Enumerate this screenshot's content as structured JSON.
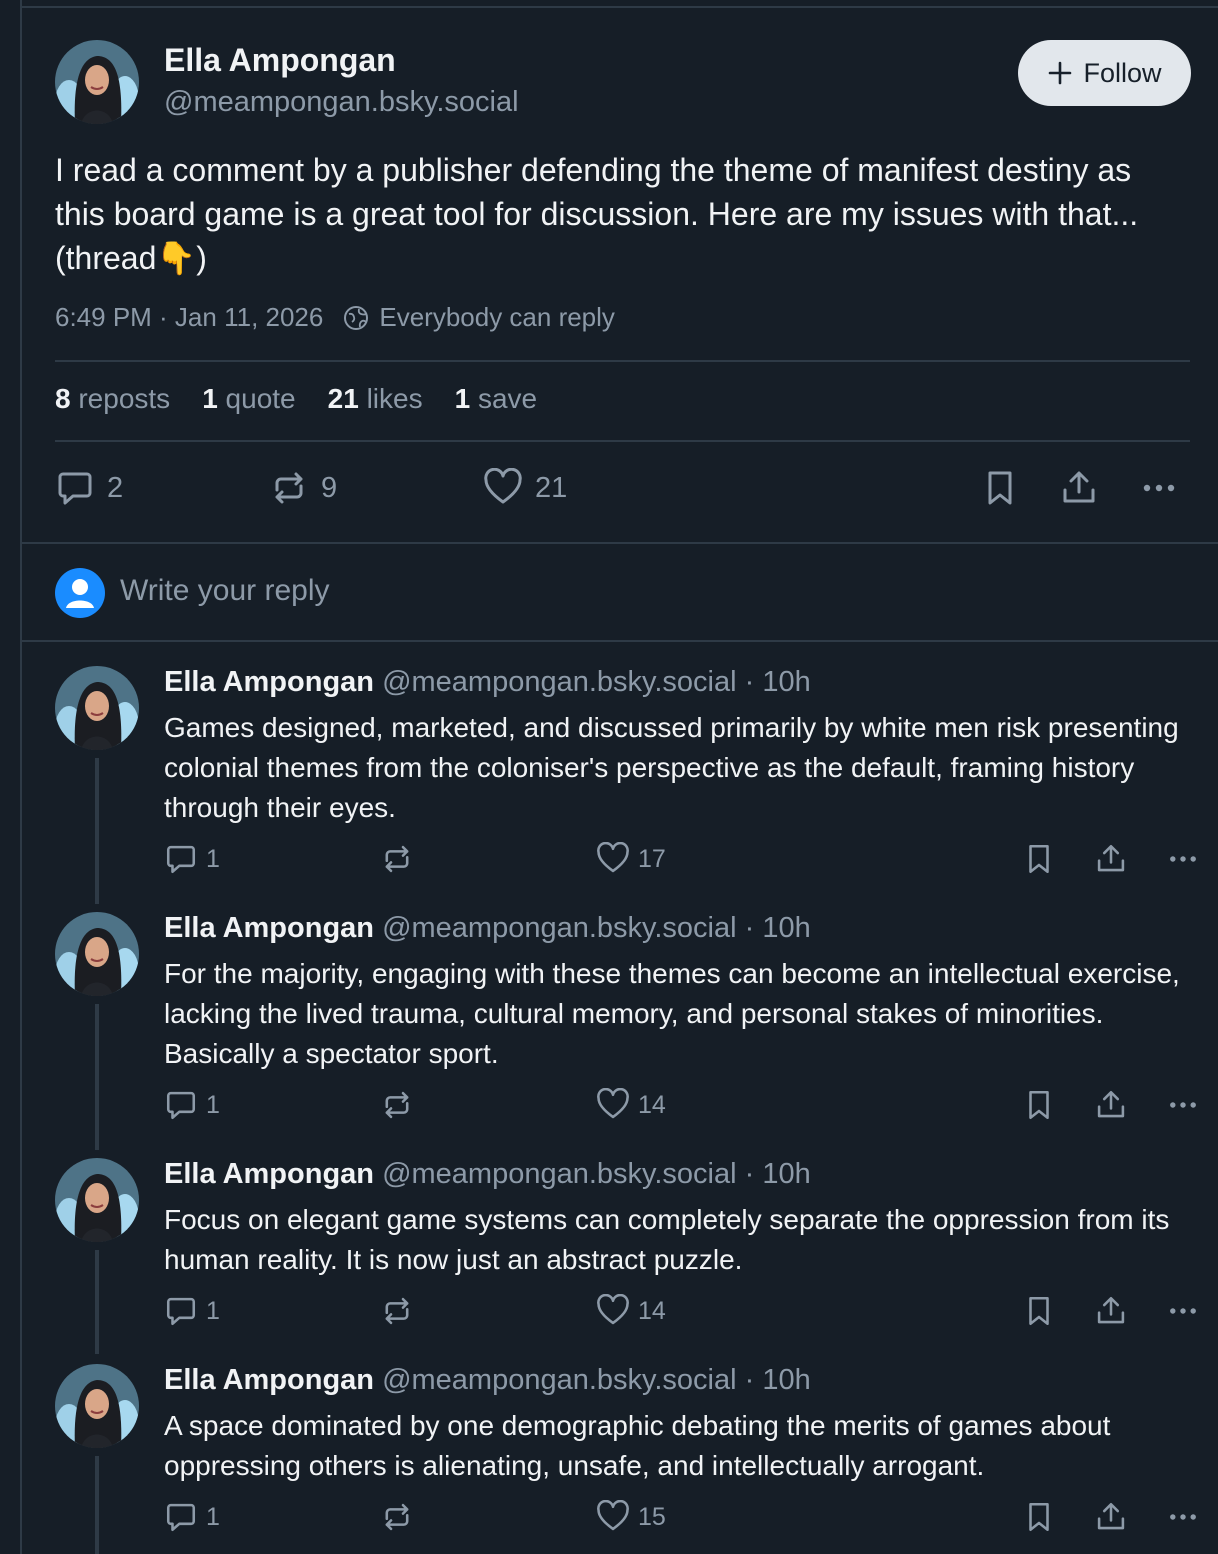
{
  "post": {
    "author_name": "Ella Ampongan",
    "author_handle": "@meampongan.bsky.social",
    "follow_label": "Follow",
    "text": "I read a comment by a publisher defending the theme of manifest destiny as this board game is a great tool for discussion. Here are my issues with that... (thread👇)",
    "timestamp": "6:49 PM · Jan 11, 2026",
    "reply_setting": "Everybody can reply",
    "stats": {
      "reposts_count": "8",
      "reposts_label": "reposts",
      "quotes_count": "1",
      "quotes_label": "quote",
      "likes_count": "21",
      "likes_label": "likes",
      "saves_count": "1",
      "saves_label": "save"
    },
    "actions": {
      "replies": "2",
      "reposts": "9",
      "likes": "21"
    }
  },
  "composer": {
    "placeholder": "Write your reply"
  },
  "thread": [
    {
      "name": "Ella Ampongan",
      "handle": "@meampongan.bsky.social · 10h",
      "text": "Games designed, marketed, and discussed primarily by white men risk presenting colonial themes from the coloniser's perspective as the default, framing history through their eyes.",
      "replies": "1",
      "likes": "17"
    },
    {
      "name": "Ella Ampongan",
      "handle": "@meampongan.bsky.social · 10h",
      "text": "For the majority, engaging with these themes can become an intellectual exercise, lacking the lived trauma, cultural memory, and personal stakes of minorities. Basically a spectator sport.",
      "replies": "1",
      "likes": "14"
    },
    {
      "name": "Ella Ampongan",
      "handle": "@meampongan.bsky.social · 10h",
      "text": "Focus on elegant game systems can completely separate the oppression from its human reality. It is now just an abstract puzzle.",
      "replies": "1",
      "likes": "14"
    },
    {
      "name": "Ella Ampongan",
      "handle": "@meampongan.bsky.social · 10h",
      "text": "A space dominated by one demographic debating the merits of games about oppressing others is alienating, unsafe, and intellectually arrogant.",
      "replies": "1",
      "likes": "15"
    }
  ],
  "icons": {
    "reply": "speech-bubble-icon",
    "repost": "repost-arrows-icon",
    "like": "heart-icon",
    "save": "bookmark-icon",
    "share": "share-icon",
    "more": "more-dots-icon"
  },
  "colors": {
    "background": "#161e27",
    "divider": "#2e3a46",
    "text_primary": "#f1f3f5",
    "text_secondary": "#8d9aa8",
    "follow_button": "#e2e7ec",
    "composer_avatar": "#1a8cff"
  }
}
